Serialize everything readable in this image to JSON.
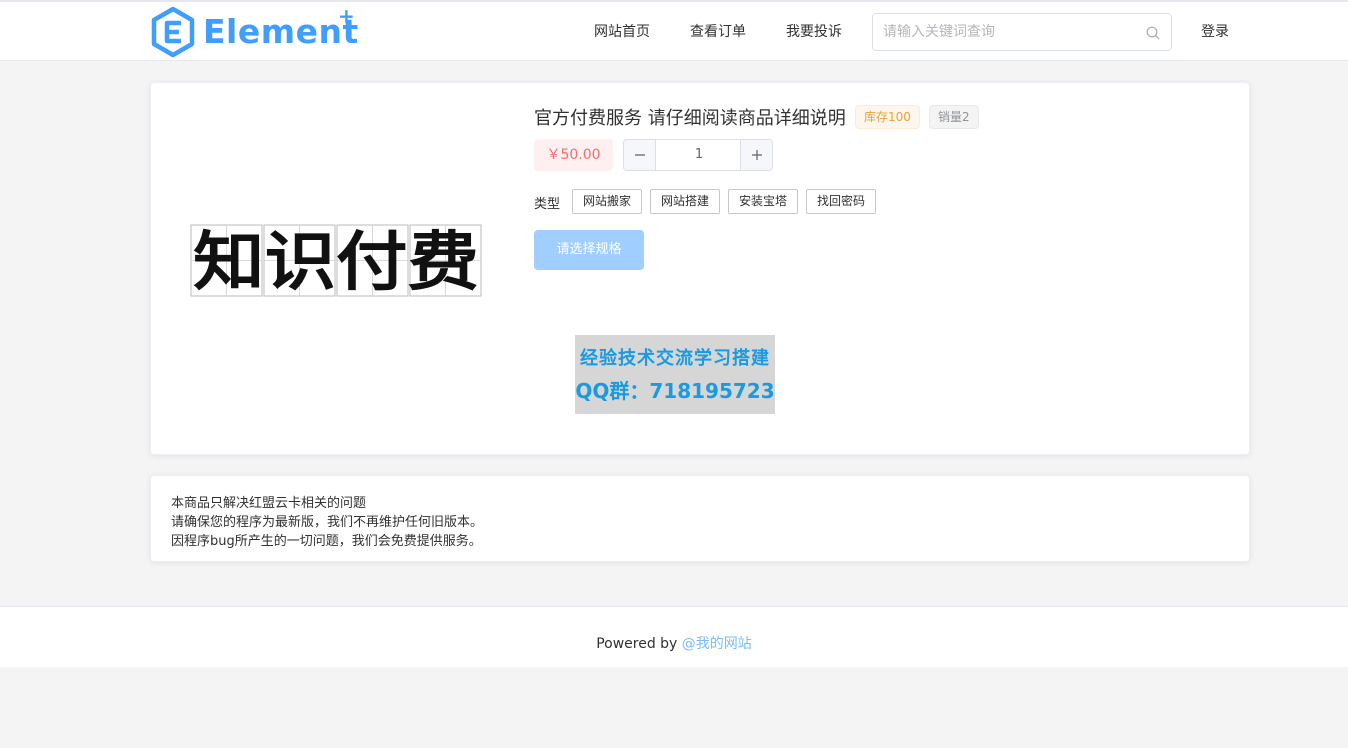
{
  "header": {
    "logo_text": "Element",
    "logo_plus": "+",
    "nav": [
      "网站首页",
      "查看订单",
      "我要投诉"
    ],
    "search_placeholder": "请输入关键词查询",
    "login": "登录"
  },
  "product": {
    "image_text": "知识付费",
    "title": "官方付费服务 请仔细阅读商品详细说明",
    "stock_tag": "库存100",
    "sales_tag": "销量2",
    "price": "￥50.00",
    "quantity": "1",
    "type_label": "类型",
    "types": [
      "网站搬家",
      "网站搭建",
      "安装宝塔",
      "找回密码"
    ],
    "select_button": "请选择规格",
    "promo_line1": "经验技术交流学习搭建",
    "promo_line2": "QQ群：718195723"
  },
  "description": [
    "本商品只解决红盟云卡相关的问题",
    "请确保您的程序为最新版，我们不再维护任何旧版本。",
    "因程序bug所产生的一切问题，我们会免费提供服务。"
  ],
  "footer": {
    "powered_by": "Powered by",
    "site_link": "@我的网站"
  },
  "colors": {
    "primary": "#409eff",
    "primary_disabled": "#a0cfff",
    "price": "#f56c6c",
    "warning": "#e6a23c"
  }
}
